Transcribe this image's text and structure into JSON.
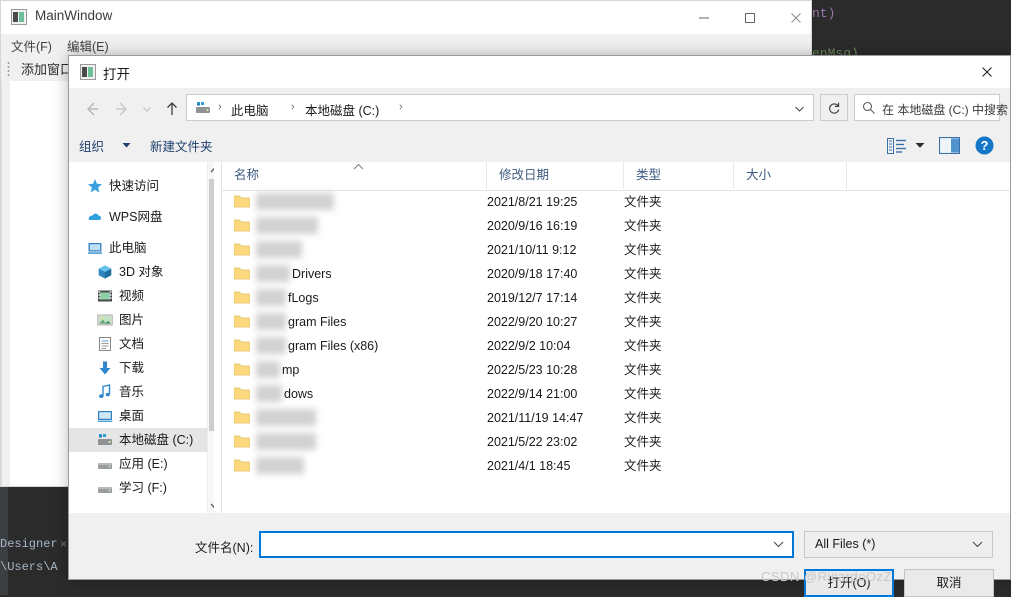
{
  "background_ide": {
    "code_fragment_1": "nt)",
    "code_fragment_2": "enMsg)",
    "tab_label": "Designer",
    "tab_close": "×",
    "path_text": "\\Users\\A"
  },
  "mainwindow": {
    "title": "MainWindow",
    "icon": "app-icon",
    "menus": [
      {
        "label": "文件(F)"
      },
      {
        "label": "编辑(E)"
      }
    ],
    "toolbar_button": "添加窗口",
    "controls": {
      "minimize": "minimize-icon",
      "maximize": "maximize-icon",
      "close": "close-icon"
    }
  },
  "dialog": {
    "title": "打开",
    "icon": "app-icon",
    "close_label": "close-icon",
    "nav": {
      "back": "back-arrow-icon",
      "forward": "forward-arrow-icon",
      "recent": "recent-chevron-icon",
      "up": "up-arrow-icon",
      "refresh": "refresh-icon",
      "address_icon": "drive-icon",
      "breadcrumbs": [
        "此电脑",
        "本地磁盘 (C:)"
      ],
      "separator": "›",
      "dropdown": "chevron-down-icon"
    },
    "search": {
      "icon": "search-icon",
      "placeholder": "在 本地磁盘 (C:) 中搜索"
    },
    "commandbar": {
      "organize": "组织",
      "organize_caret": "caret-down-icon",
      "new_folder": "新建文件夹",
      "view_mode": "view-mode-icon",
      "view_caret": "caret-down-icon",
      "preview_pane": "preview-pane-icon",
      "help": "help-icon"
    },
    "sidebar": {
      "items": [
        {
          "label": "快速访问",
          "icon": "star-icon",
          "indent": false,
          "selected": false
        },
        {
          "label": "WPS网盘",
          "icon": "cloud-icon",
          "indent": false,
          "selected": false
        },
        {
          "label": "此电脑",
          "icon": "computer-icon",
          "indent": false,
          "selected": false
        },
        {
          "label": "3D 对象",
          "icon": "cube-icon",
          "indent": true,
          "selected": false
        },
        {
          "label": "视频",
          "icon": "video-icon",
          "indent": true,
          "selected": false
        },
        {
          "label": "图片",
          "icon": "picture-icon",
          "indent": true,
          "selected": false
        },
        {
          "label": "文档",
          "icon": "document-icon",
          "indent": true,
          "selected": false
        },
        {
          "label": "下载",
          "icon": "download-icon",
          "indent": true,
          "selected": false
        },
        {
          "label": "音乐",
          "icon": "music-icon",
          "indent": true,
          "selected": false
        },
        {
          "label": "桌面",
          "icon": "desktop-icon",
          "indent": true,
          "selected": false
        },
        {
          "label": "本地磁盘 (C:)",
          "icon": "drive-icon",
          "indent": true,
          "selected": true
        },
        {
          "label": "应用 (E:)",
          "icon": "drive-gray-icon",
          "indent": true,
          "selected": false
        },
        {
          "label": "学习 (F:)",
          "icon": "drive-gray-icon",
          "indent": true,
          "selected": false
        }
      ],
      "scroll_up": "scroll-up-arrow",
      "scroll_down": "scroll-down-arrow"
    },
    "filelist": {
      "columns": [
        "名称",
        "修改日期",
        "类型",
        "大小"
      ],
      "sort_indicator": "caret-up-icon",
      "rows": [
        {
          "name": "",
          "blur_width": 78,
          "date": "2021/8/21 19:25",
          "type": "文件夹",
          "size": ""
        },
        {
          "name": "",
          "blur_width": 62,
          "date": "2020/9/16 16:19",
          "type": "文件夹",
          "size": ""
        },
        {
          "name": "",
          "blur_width": 46,
          "date": "2021/10/11 9:12",
          "type": "文件夹",
          "size": ""
        },
        {
          "name": "Drivers",
          "blur_width": 34,
          "date": "2020/9/18 17:40",
          "type": "文件夹",
          "size": ""
        },
        {
          "name": "fLogs",
          "blur_width": 30,
          "date": "2019/12/7 17:14",
          "type": "文件夹",
          "size": ""
        },
        {
          "name": "gram Files",
          "blur_width": 30,
          "date": "2022/9/20 10:27",
          "type": "文件夹",
          "size": ""
        },
        {
          "name": "gram Files (x86)",
          "blur_width": 30,
          "date": "2022/9/2 10:04",
          "type": "文件夹",
          "size": ""
        },
        {
          "name": "mp",
          "blur_width": 24,
          "date": "2022/5/23 10:28",
          "type": "文件夹",
          "size": ""
        },
        {
          "name": "dows",
          "blur_width": 26,
          "date": "2022/9/14 21:00",
          "type": "文件夹",
          "size": ""
        },
        {
          "name": "",
          "blur_width": 60,
          "date": "2021/11/19 14:47",
          "type": "文件夹",
          "size": ""
        },
        {
          "name": "",
          "blur_width": 60,
          "date": "2021/5/22 23:02",
          "type": "文件夹",
          "size": ""
        },
        {
          "name": "",
          "blur_width": 48,
          "date": "2021/4/1 18:45",
          "type": "文件夹",
          "size": ""
        }
      ]
    },
    "bottom": {
      "filename_label": "文件名(N):",
      "filename_value": "",
      "filename_caret": "chevron-down-icon",
      "filter_value": "All Files (*)",
      "filter_caret": "chevron-down-icon",
      "open_button": "打开(O)",
      "cancel_button": "取消"
    }
  },
  "watermark": "CSDN @RicardoOzZ",
  "colors": {
    "accent": "#0078d7",
    "link": "#1f3f6e",
    "folder": "#ffd77a",
    "selection": "#e5e5e5"
  }
}
